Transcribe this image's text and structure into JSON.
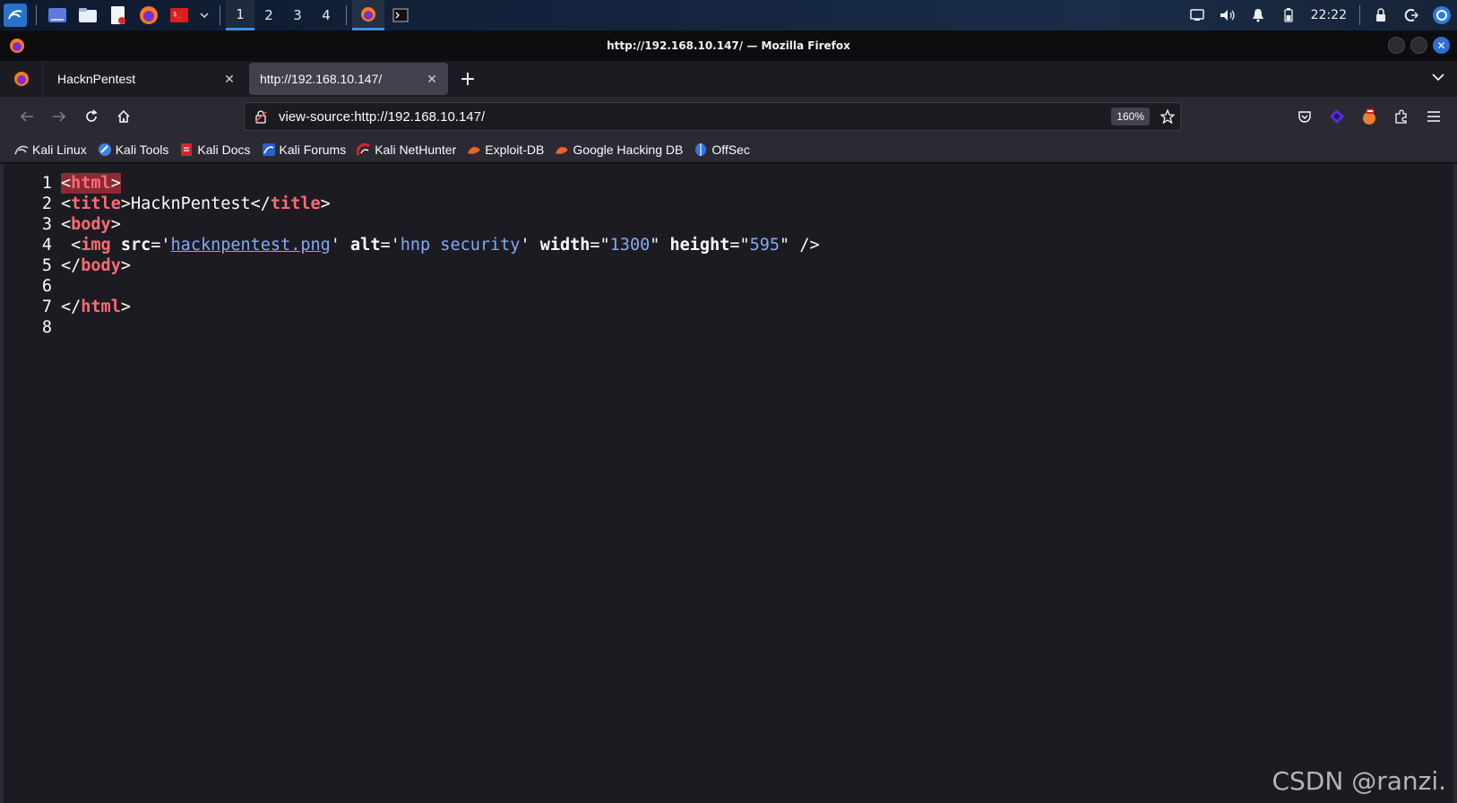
{
  "panel": {
    "workspaces": [
      "1",
      "2",
      "3",
      "4"
    ],
    "active_workspace": "1",
    "clock": "22:22"
  },
  "window": {
    "title": "http://192.168.10.147/ — Mozilla Firefox"
  },
  "tabs": [
    {
      "label": "HacknPentest",
      "selected": false
    },
    {
      "label": "http://192.168.10.147/",
      "selected": true
    }
  ],
  "navbar": {
    "url": "view-source:http://192.168.10.147/",
    "zoom": "160%"
  },
  "bookmarks": [
    {
      "label": "Kali Linux",
      "icon": "kali-dragon-icon"
    },
    {
      "label": "Kali Tools",
      "icon": "kali-tools-icon"
    },
    {
      "label": "Kali Docs",
      "icon": "kali-docs-icon"
    },
    {
      "label": "Kali Forums",
      "icon": "kali-forums-icon"
    },
    {
      "label": "Kali NetHunter",
      "icon": "kali-nethunter-icon"
    },
    {
      "label": "Exploit-DB",
      "icon": "exploit-db-icon"
    },
    {
      "label": "Google Hacking DB",
      "icon": "ghdb-icon"
    },
    {
      "label": "OffSec",
      "icon": "offsec-icon"
    }
  ],
  "source": {
    "line_numbers": [
      "1",
      "2",
      "3",
      "4",
      "5",
      "6",
      "7",
      "8"
    ],
    "l1": {
      "open": "<",
      "tag": "html",
      "close": ">"
    },
    "l2": {
      "lt1": "<",
      "tag1": "title",
      "gt1": ">",
      "text": "HacknPentest",
      "lt2": "</",
      "tag2": "title",
      "gt2": ">"
    },
    "l3": {
      "lt": "<",
      "tag": "body",
      "gt": ">"
    },
    "l4": {
      "lead": " <",
      "tag": "img",
      "sp1": " ",
      "a1": "src",
      "eq1": "='",
      "v1": "hacknpentest.png",
      "q1": "' ",
      "a2": "alt",
      "eq2": "='",
      "v2": "hnp security",
      "q2": "' ",
      "a3": "width",
      "eq3": "=\"",
      "v3": "1300",
      "q3": "\" ",
      "a4": "height",
      "eq4": "=\"",
      "v4": "595",
      "q4": "\" />"
    },
    "l5": {
      "lt": "</",
      "tag": "body",
      "gt": ">"
    },
    "l7": {
      "lt": "</",
      "tag": "html",
      "gt": ">"
    }
  },
  "watermark": "CSDN @ranzi.",
  "colors": {
    "accent": "#3d8ee0",
    "tag": "#ff6a75",
    "value": "#86a9f0",
    "background": "#1c1b22",
    "toolbar": "#2b2a33"
  }
}
